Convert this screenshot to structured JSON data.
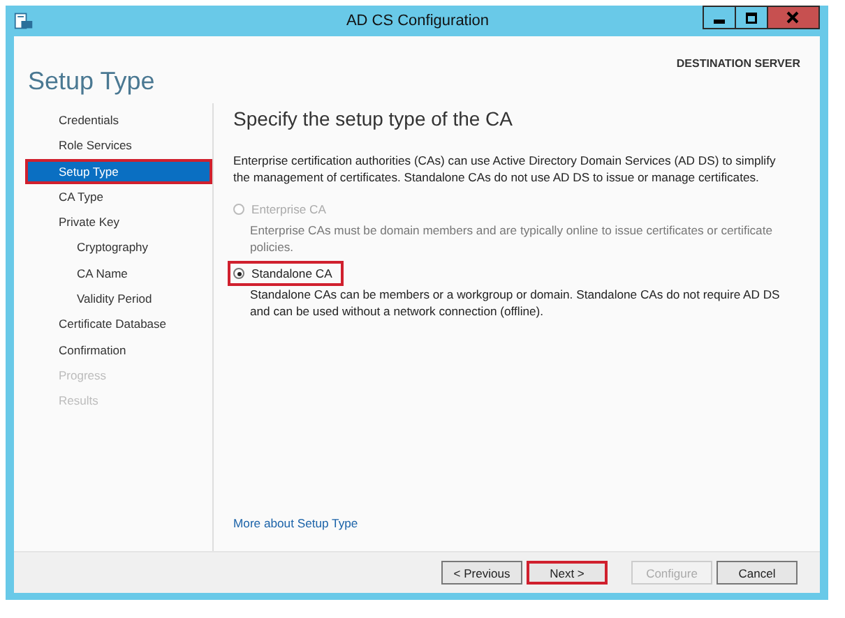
{
  "window": {
    "title": "AD CS Configuration"
  },
  "header": {
    "page_title": "Setup Type",
    "server_label": "DESTINATION SERVER"
  },
  "nav": [
    {
      "label": "Credentials",
      "selected": false,
      "disabled": false,
      "highlighted": false
    },
    {
      "label": "Role Services",
      "selected": false,
      "disabled": false,
      "highlighted": false
    },
    {
      "label": "Setup Type",
      "selected": true,
      "disabled": false,
      "highlighted": true
    },
    {
      "label": "CA Type",
      "selected": false,
      "disabled": false,
      "highlighted": false
    },
    {
      "label": "Private Key",
      "selected": false,
      "disabled": false,
      "highlighted": false,
      "children": [
        {
          "label": "Cryptography",
          "selected": false,
          "disabled": false,
          "highlighted": false
        },
        {
          "label": "CA Name",
          "selected": false,
          "disabled": false,
          "highlighted": false
        },
        {
          "label": "Validity Period",
          "selected": false,
          "disabled": false,
          "highlighted": false
        }
      ]
    },
    {
      "label": "Certificate Database",
      "selected": false,
      "disabled": false,
      "highlighted": false
    },
    {
      "label": "Confirmation",
      "selected": false,
      "disabled": false,
      "highlighted": false
    },
    {
      "label": "Progress",
      "selected": false,
      "disabled": true,
      "highlighted": false
    },
    {
      "label": "Results",
      "selected": false,
      "disabled": true,
      "highlighted": false
    }
  ],
  "main": {
    "heading": "Specify the setup type of the CA",
    "intro": "Enterprise certification authorities (CAs) can use Active Directory Domain Services (AD DS) to simplify the management of certificates. Standalone CAs do not use AD DS to issue or manage certificates.",
    "options": [
      {
        "label": "Enterprise CA",
        "description": "Enterprise CAs must be domain members and are typically online to issue certificates or certificate policies.",
        "selected": false,
        "disabled": true,
        "highlighted": false
      },
      {
        "label": "Standalone CA",
        "description": "Standalone CAs can be members or a workgroup or domain. Standalone CAs do not require AD DS and can be used without a network connection (offline).",
        "selected": true,
        "disabled": false,
        "highlighted": true
      }
    ],
    "link": "More about Setup Type"
  },
  "buttons": [
    {
      "label": "< Previous",
      "disabled": false,
      "highlighted": false
    },
    {
      "label": "Next >",
      "disabled": false,
      "highlighted": true
    },
    {
      "label": "Configure",
      "disabled": true,
      "highlighted": false
    },
    {
      "label": "Cancel",
      "disabled": false,
      "highlighted": false
    }
  ]
}
